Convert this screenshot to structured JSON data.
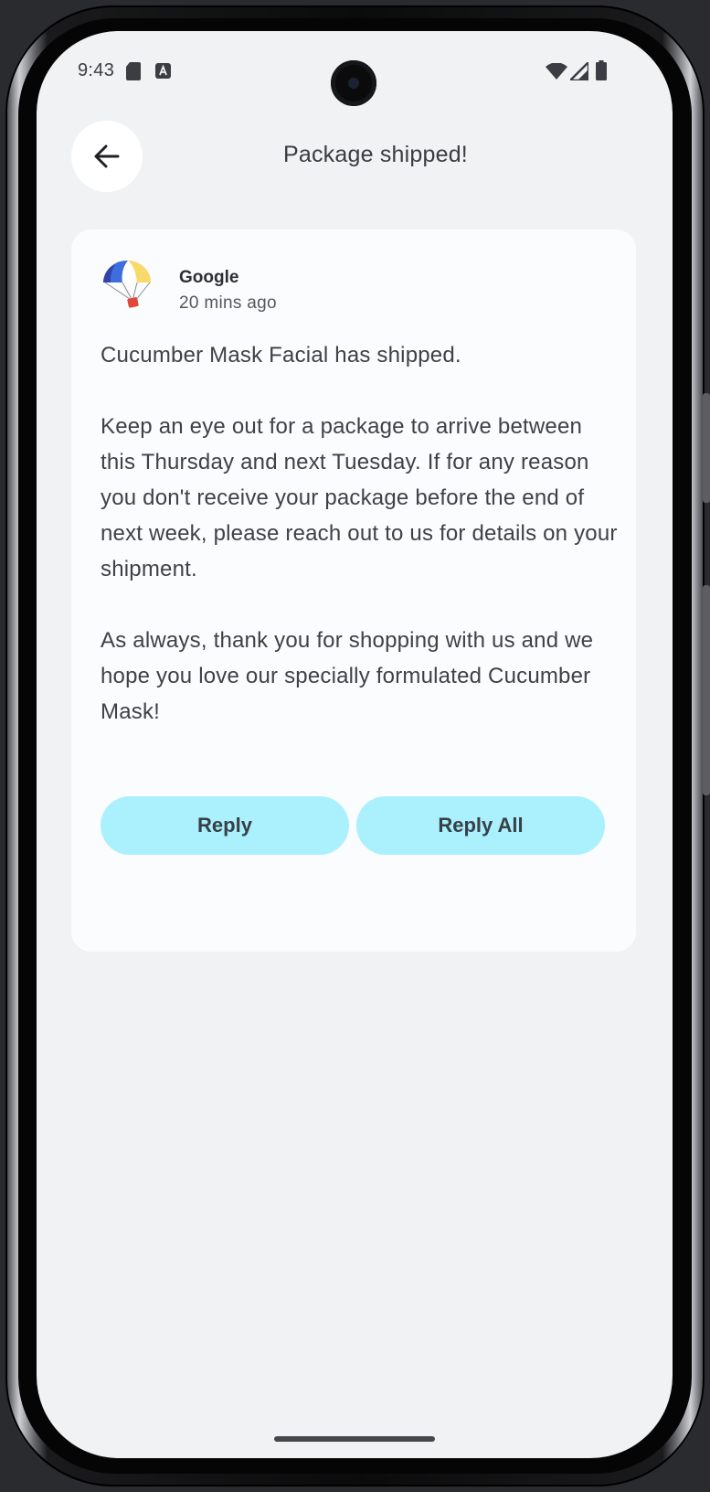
{
  "status_bar": {
    "time": "9:43",
    "icons": [
      "sd-card-icon",
      "notification-a-icon",
      "wifi-icon",
      "signal-icon",
      "battery-icon"
    ]
  },
  "app_bar": {
    "back_icon": "arrow-left-icon",
    "title": "Package shipped!"
  },
  "email": {
    "sender": "Google",
    "time_ago": "20 mins ago",
    "avatar_icon": "parachute-icon",
    "paragraphs": [
      "Cucumber Mask Facial has shipped.",
      "Keep an eye out for a package to arrive between this Thursday and next Tuesday. If for any reason you don't receive your package before the end of next week, please reach out to us for details on your shipment.",
      "As always, thank you for shopping with us and we hope you love our specially formulated Cucumber Mask!"
    ],
    "actions": {
      "reply": "Reply",
      "reply_all": "Reply All"
    }
  },
  "colors": {
    "background": "#f1f2f4",
    "card": "#fbfcfd",
    "button": "#aaf0fd",
    "text": "#3f4146"
  }
}
